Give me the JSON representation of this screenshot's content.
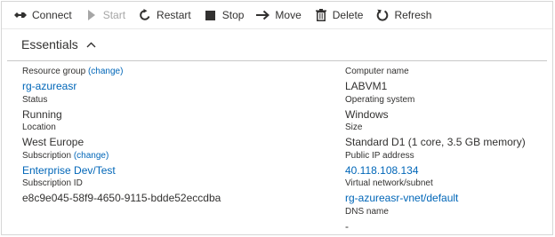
{
  "toolbar": {
    "connect": "Connect",
    "start": "Start",
    "restart": "Restart",
    "stop": "Stop",
    "move": "Move",
    "delete": "Delete",
    "refresh": "Refresh"
  },
  "essentials": {
    "title": "Essentials"
  },
  "left_fields": {
    "resource_group": {
      "label": "Resource group",
      "change": "(change)",
      "value": "rg-azureasr"
    },
    "status": {
      "label": "Status",
      "value": "Running"
    },
    "location": {
      "label": "Location",
      "value": "West Europe"
    },
    "subscription": {
      "label": "Subscription",
      "change": "(change)",
      "value": "Enterprise Dev/Test"
    },
    "subscription_id": {
      "label": "Subscription ID",
      "value": "e8c9e045-58f9-4650-9115-bdde52eccdba"
    }
  },
  "right_fields": {
    "computer_name": {
      "label": "Computer name",
      "value": "LABVM1"
    },
    "os": {
      "label": "Operating system",
      "value": "Windows"
    },
    "size": {
      "label": "Size",
      "value": "Standard D1 (1 core, 3.5 GB memory)"
    },
    "public_ip": {
      "label": "Public IP address",
      "value": "40.118.108.134"
    },
    "vnet": {
      "label": "Virtual network/subnet",
      "value": "rg-azureasr-vnet/default"
    },
    "dns": {
      "label": "DNS name",
      "value": "-"
    }
  },
  "colors": {
    "link": "#0066b8",
    "text": "#323130",
    "disabled": "#a6a6a6"
  },
  "icons": {
    "connect": "connect-icon",
    "start": "play-icon",
    "restart": "restart-icon",
    "stop": "stop-icon",
    "move": "arrow-right-icon",
    "delete": "trash-icon",
    "refresh": "refresh-icon",
    "collapse": "chevron-up-icon"
  }
}
